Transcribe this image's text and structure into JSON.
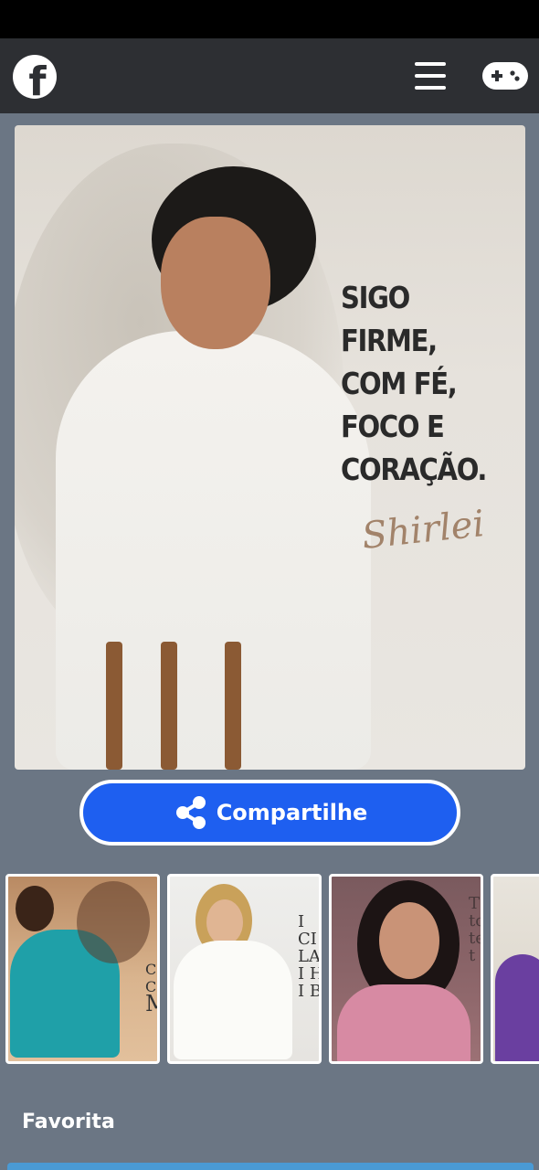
{
  "header": {
    "logo_icon": "facebook-icon",
    "logo_glyph": "f",
    "menu_icon": "hamburger-menu-icon",
    "game_icon": "gamepad-icon"
  },
  "hero": {
    "quote": [
      "SIGO",
      "FIRME,",
      "COM FÉ,",
      "FOCO E",
      "CORAÇÃO."
    ],
    "signature": "Shirlei"
  },
  "share": {
    "label": "Compartilhe",
    "icon": "share-icon",
    "color": "#1e5ff0"
  },
  "thumbnails": [
    {
      "name": "thumbnail-1",
      "text": [
        "C",
        "C",
        "M"
      ]
    },
    {
      "name": "thumbnail-2",
      "text": [
        "I",
        "CI",
        "LAT",
        "I H",
        "I BI"
      ]
    },
    {
      "name": "thumbnail-3",
      "text": [
        "T",
        "to",
        "te",
        "t"
      ]
    },
    {
      "name": "thumbnail-4",
      "text": []
    }
  ],
  "section": {
    "title": "Favorita"
  }
}
